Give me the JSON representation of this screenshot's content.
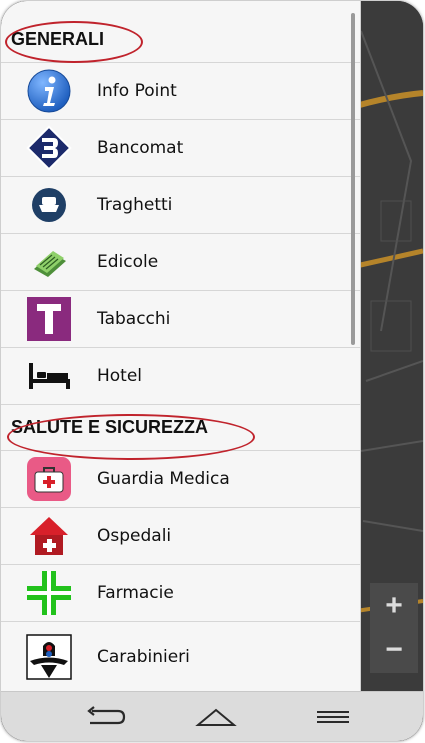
{
  "sections": [
    {
      "title": "GENERALI",
      "items": [
        {
          "label": "Info Point",
          "icon": "info-icon"
        },
        {
          "label": "Bancomat",
          "icon": "bancomat-icon"
        },
        {
          "label": "Traghetti",
          "icon": "ferry-icon"
        },
        {
          "label": "Edicole",
          "icon": "newspaper-icon"
        },
        {
          "label": "Tabacchi",
          "icon": "tobacco-icon"
        },
        {
          "label": "Hotel",
          "icon": "bed-icon"
        }
      ]
    },
    {
      "title": "SALUTE E SICUREZZA",
      "items": [
        {
          "label": "Guardia Medica",
          "icon": "first-aid-kit-icon"
        },
        {
          "label": "Ospedali",
          "icon": "hospital-icon"
        },
        {
          "label": "Farmacie",
          "icon": "pharmacy-cross-icon"
        },
        {
          "label": "Carabinieri",
          "icon": "carabinieri-icon"
        }
      ]
    }
  ],
  "map_controls": {
    "zoom_in": "+",
    "zoom_out": "−"
  },
  "navbar": {
    "back": "back-icon",
    "home": "home-icon",
    "menu": "menu-icon"
  },
  "colors": {
    "highlight": "#c0232c",
    "info": "#1f5fbf",
    "bancomat": "#1c2a6b",
    "ferry": "#1f3f66",
    "tobacco": "#8a2a7e",
    "pharmacy": "#22c21c",
    "hospital": "#d8202a",
    "medical": "#e95a86"
  }
}
